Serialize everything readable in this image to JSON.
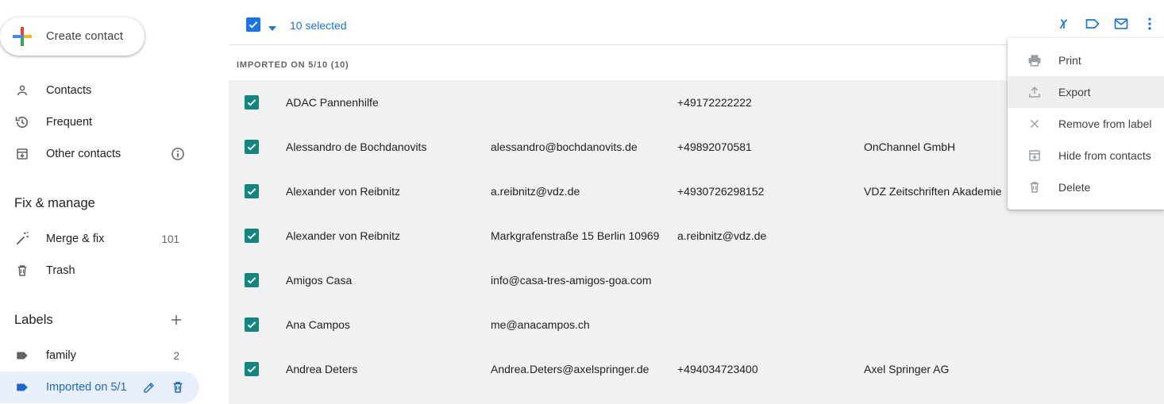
{
  "sidebar": {
    "create_label": "Create contact",
    "nav": [
      {
        "label": "Contacts",
        "icon": "person-icon"
      },
      {
        "label": "Frequent",
        "icon": "history-icon"
      },
      {
        "label": "Other contacts",
        "icon": "archive-icon",
        "info_icon": "info-icon"
      }
    ],
    "fix_manage_title": "Fix & manage",
    "fix_items": [
      {
        "label": "Merge & fix",
        "count": "101",
        "icon": "magic-wand-icon"
      },
      {
        "label": "Trash",
        "icon": "trash-icon"
      }
    ],
    "labels_title": "Labels",
    "labels": [
      {
        "label": "family",
        "count": "2",
        "icon": "label-icon"
      },
      {
        "label": "Imported on 5/1",
        "icon": "label-icon",
        "active": true
      }
    ]
  },
  "toolbar": {
    "selected_text": "10 selected",
    "icons": [
      "merge-icon",
      "label-icon",
      "email-icon",
      "more-vert-icon"
    ]
  },
  "group_heading": "IMPORTED ON 5/10 (10)",
  "rows": [
    {
      "name": "ADAC Pannenhilfe",
      "col2": "",
      "col3": "+49172222222",
      "col4": ""
    },
    {
      "name": "Alessandro de Bochdanovits",
      "col2": "alessandro@bochdanovits.de",
      "col3": "+49892070581",
      "col4": "OnChannel GmbH"
    },
    {
      "name": "Alexander von Reibnitz",
      "col2": "a.reibnitz@vdz.de",
      "col3": "+4930726298152",
      "col4": "VDZ Zeitschriften Akademie"
    },
    {
      "name": "Alexander von Reibnitz",
      "col2": "Markgrafenstraße 15 Berlin 10969",
      "col3": "a.reibnitz@vdz.de",
      "col4": ""
    },
    {
      "name": "Amigos Casa",
      "col2": "info@casa-tres-amigos-goa.com",
      "col3": "",
      "col4": ""
    },
    {
      "name": "Ana Campos",
      "col2": "me@anacampos.ch",
      "col3": "",
      "col4": ""
    },
    {
      "name": "Andrea Deters",
      "col2": "Andrea.Deters@axelspringer.de",
      "col3": "+494034723400",
      "col4": "Axel Springer AG"
    }
  ],
  "menu": [
    {
      "label": "Print",
      "icon": "print-icon"
    },
    {
      "label": "Export",
      "icon": "upload-icon",
      "highlighted": true
    },
    {
      "label": "Remove from label",
      "icon": "close-icon"
    },
    {
      "label": "Hide from contacts",
      "icon": "archive-icon"
    },
    {
      "label": "Delete",
      "icon": "trash-icon"
    }
  ],
  "colors": {
    "accent": "#1a73e8",
    "row_checkbox": "#12867c",
    "row_background": "#f1f1f1",
    "active_label_bg": "#e8f0fe"
  }
}
